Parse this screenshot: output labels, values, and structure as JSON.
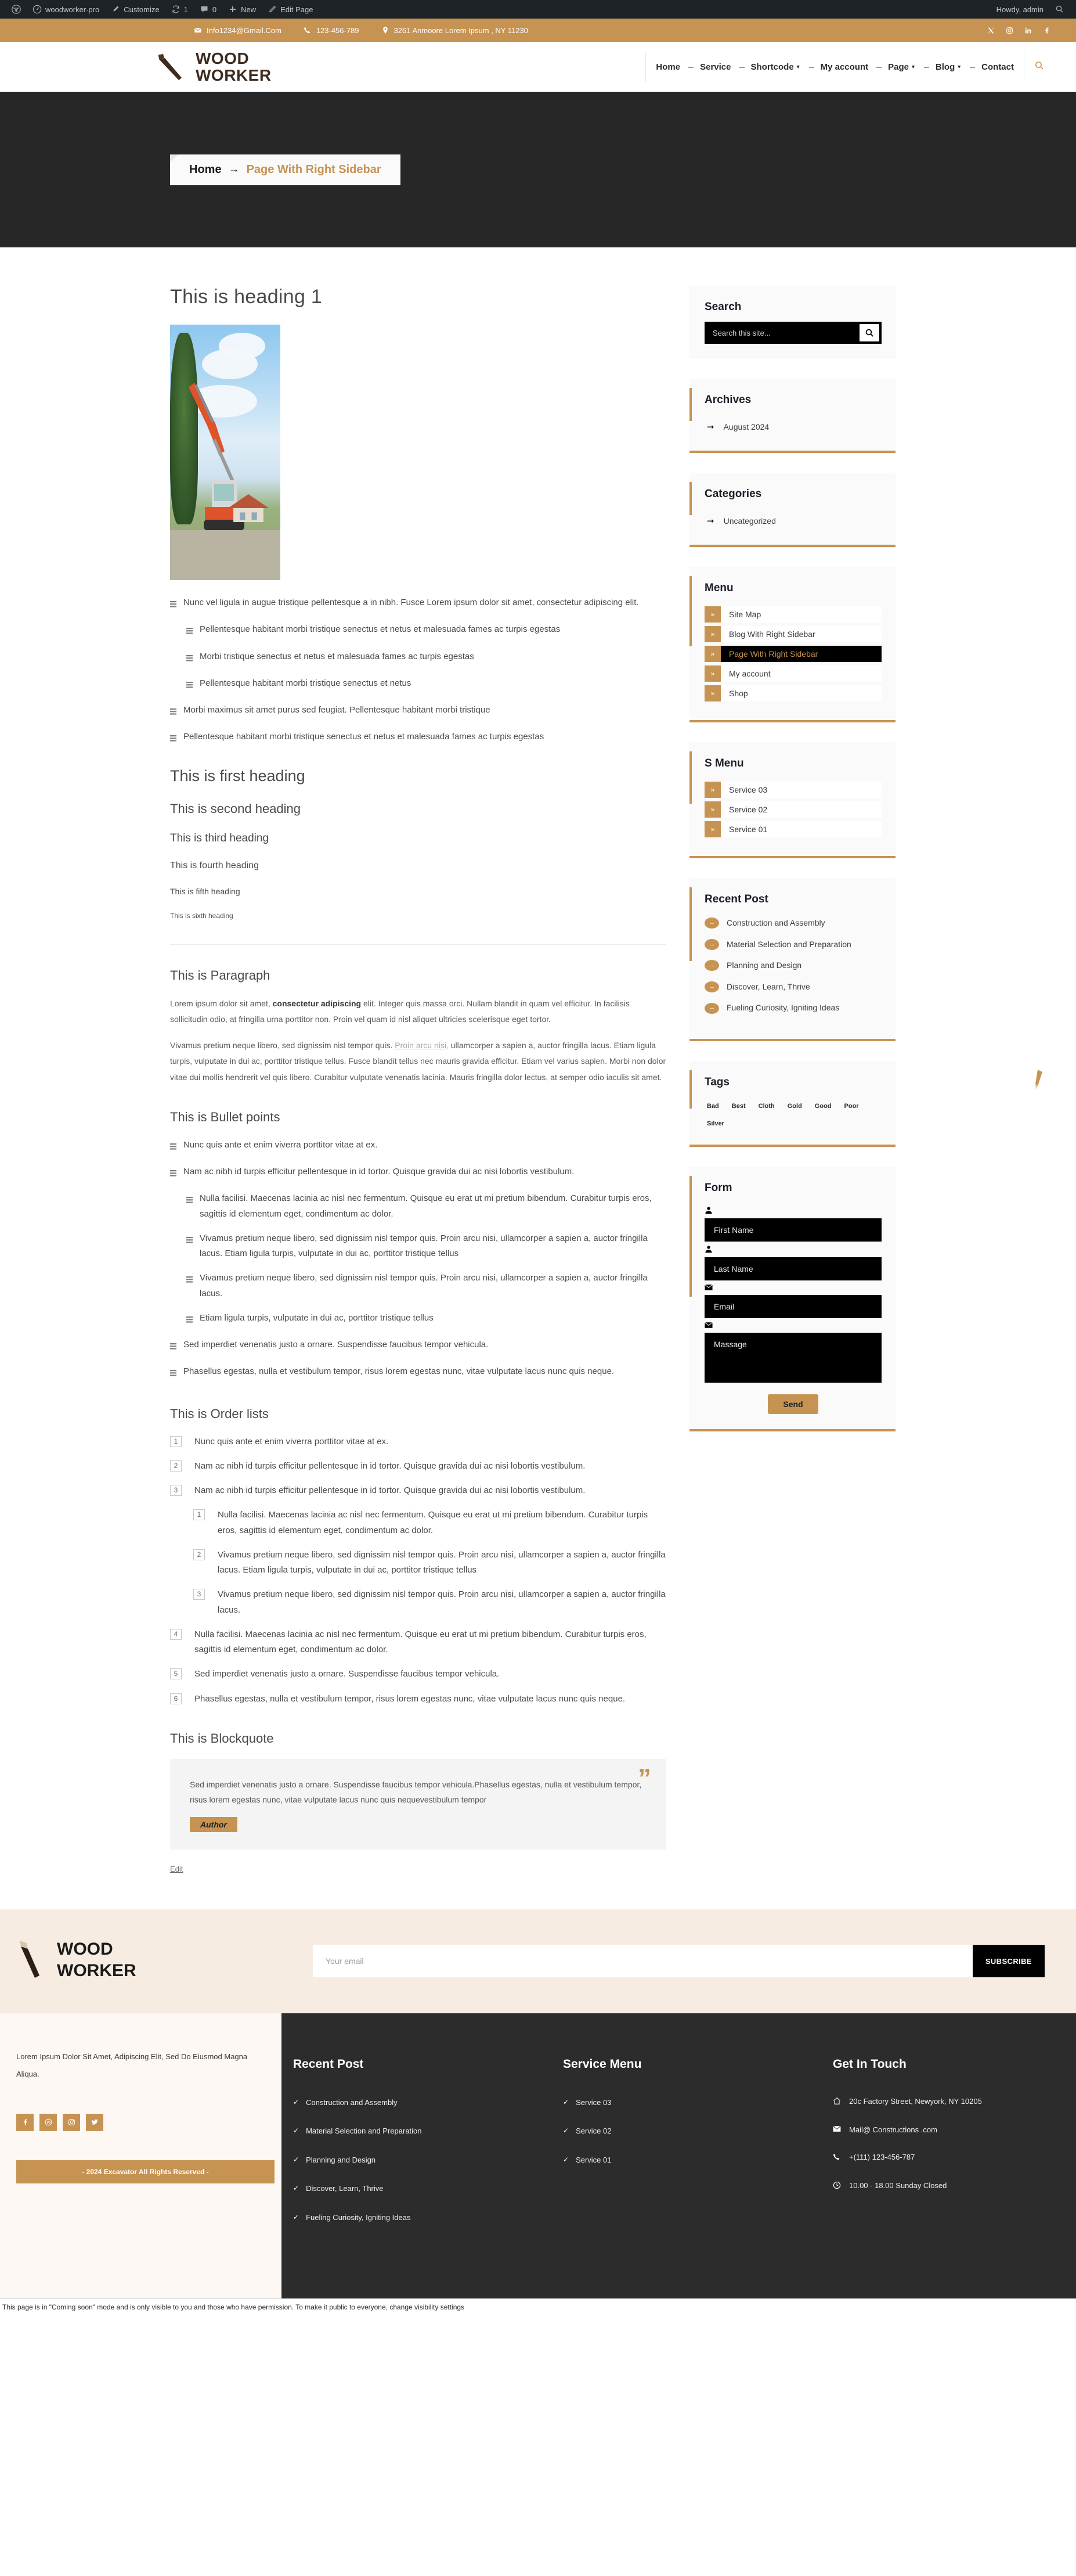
{
  "adminbar": {
    "items": [
      {
        "icon": "wordpress-logo-icon",
        "label": ""
      },
      {
        "icon": "dashboard-icon",
        "label": "woodworker-pro"
      },
      {
        "icon": "brush-icon",
        "label": "Customize"
      },
      {
        "icon": "updates-icon",
        "label": "1"
      },
      {
        "icon": "comment-icon",
        "label": "0"
      },
      {
        "icon": "plus-icon",
        "label": "New"
      },
      {
        "icon": "pencil-icon",
        "label": "Edit Page"
      }
    ],
    "howdy": "Howdy, admin"
  },
  "topbar": {
    "email": "Info1234@Gmail.Com",
    "phone": "123-456-789",
    "address": "3261 Anmoore Lorem Ipsum , NY 11230",
    "socials": [
      "x-icon",
      "instagram-icon",
      "linkedin-icon",
      "facebook-icon"
    ]
  },
  "header": {
    "brand_line1": "WOOD",
    "brand_line2": "WORKER",
    "nav": [
      {
        "label": "Home",
        "has_caret": false
      },
      {
        "label": "Service",
        "has_caret": false
      },
      {
        "label": "Shortcode",
        "has_caret": true
      },
      {
        "label": "My account",
        "has_caret": false
      },
      {
        "label": "Page",
        "has_caret": true
      },
      {
        "label": "Blog",
        "has_caret": true
      },
      {
        "label": "Contact",
        "has_caret": false
      }
    ]
  },
  "banner": {
    "home": "Home",
    "arrow": "→",
    "current": "Page With Right Sidebar"
  },
  "content": {
    "heading1": "This is heading 1",
    "bullets_top": [
      {
        "level": 0,
        "text": "Nunc vel ligula in augue tristique pellentesque a in nibh. Fusce Lorem ipsum dolor sit amet, consectetur adipiscing elit."
      },
      {
        "level": 1,
        "text": "Pellentesque habitant morbi tristique senectus et netus et malesuada fames ac turpis egestas"
      },
      {
        "level": 1,
        "text": "Morbi tristique senectus et netus et malesuada fames ac turpis egestas"
      },
      {
        "level": 1,
        "text": "Pellentesque habitant morbi tristique senectus et netus"
      },
      {
        "level": 0,
        "text": "Morbi maximus sit amet purus sed feugiat. Pellentesque habitant morbi tristique"
      },
      {
        "level": 0,
        "text": "Pellentesque habitant morbi tristique senectus et netus et malesuada fames ac turpis egestas"
      }
    ],
    "h_first": "This is first heading",
    "h_second": "This is second heading",
    "h_third": "This is third heading",
    "h_fourth": "This is fourth heading",
    "h_fifth": "This is fifth heading",
    "h_sixth": "This is sixth heading",
    "paragraph_title": "This is Paragraph",
    "para1_a": "Lorem ipsum dolor sit amet, ",
    "para1_b": "consectetur adipiscing",
    "para1_c": " elit. Integer quis massa orci. Nullam blandit in quam vel efficitur. In facilisis sollicitudin odio, at fringilla urna porttitor non. Proin vel quam id nisl aliquet ultricies scelerisque eget tortor.",
    "para2_a": "Vivamus pretium neque libero, sed dignissim nisl tempor quis. ",
    "para2_link": "Proin arcu nisi,",
    "para2_b": " ullamcorper a sapien a, auctor fringilla lacus. Etiam ligula turpis, vulputate in dui ac, porttitor tristique tellus. Fusce blandit tellus nec mauris gravida efficitur. Etiam vel varius sapien. Morbi non dolor vitae dui mollis hendrerit vel quis libero. Curabitur vulputate venenatis lacinia. Mauris fringilla dolor lectus, at semper odio iaculis sit amet.",
    "bullet_title": "This is Bullet points",
    "bullets_main": [
      {
        "level": 0,
        "text": "Nunc quis ante et enim viverra porttitor vitae at ex."
      },
      {
        "level": 0,
        "text": "Nam ac nibh id turpis efficitur pellentesque in id tortor. Quisque gravida dui ac nisi lobortis vestibulum."
      },
      {
        "level": 1,
        "text": "Nulla facilisi. Maecenas lacinia ac nisl nec fermentum. Quisque eu erat ut mi pretium bibendum. Curabitur turpis eros, sagittis id elementum eget, condimentum ac dolor."
      },
      {
        "level": 1,
        "text": "Vivamus pretium neque libero, sed dignissim nisl tempor quis. Proin arcu nisi, ullamcorper a sapien a, auctor fringilla lacus. Etiam ligula turpis, vulputate in dui ac, porttitor tristique tellus"
      },
      {
        "level": 1,
        "text": "Vivamus pretium neque libero, sed dignissim nisl tempor quis. Proin arcu nisi, ullamcorper a sapien a, auctor fringilla lacus."
      },
      {
        "level": 1,
        "text": "Etiam ligula turpis, vulputate in dui ac, porttitor tristique tellus"
      },
      {
        "level": 0,
        "text": "Sed imperdiet venenatis justo a ornare. Suspendisse faucibus tempor vehicula."
      },
      {
        "level": 0,
        "text": "Phasellus egestas, nulla et vestibulum tempor, risus lorem egestas nunc, vitae vulputate lacus nunc quis neque."
      }
    ],
    "order_title": "This is Order lists",
    "order_list": [
      {
        "level": 0,
        "num": "1",
        "text": "Nunc quis ante et enim viverra porttitor vitae at ex."
      },
      {
        "level": 0,
        "num": "2",
        "text": "Nam ac nibh id turpis efficitur pellentesque in id tortor. Quisque gravida dui ac nisi lobortis vestibulum."
      },
      {
        "level": 0,
        "num": "3",
        "text": "Nam ac nibh id turpis efficitur pellentesque in id tortor. Quisque gravida dui ac nisi lobortis vestibulum."
      },
      {
        "level": 1,
        "num": "1",
        "text": "Nulla facilisi. Maecenas lacinia ac nisl nec fermentum. Quisque eu erat ut mi pretium bibendum. Curabitur turpis eros, sagittis id elementum eget, condimentum ac dolor."
      },
      {
        "level": 1,
        "num": "2",
        "text": "Vivamus pretium neque libero, sed dignissim nisl tempor quis. Proin arcu nisi, ullamcorper a sapien a, auctor fringilla lacus. Etiam ligula turpis, vulputate in dui ac, porttitor tristique tellus"
      },
      {
        "level": 1,
        "num": "3",
        "text": "Vivamus pretium neque libero, sed dignissim nisl tempor quis. Proin arcu nisi, ullamcorper a sapien a, auctor fringilla lacus."
      },
      {
        "level": 0,
        "num": "4",
        "text": "Nulla facilisi. Maecenas lacinia ac nisl nec fermentum. Quisque eu erat ut mi pretium bibendum. Curabitur turpis eros, sagittis id elementum eget, condimentum ac dolor."
      },
      {
        "level": 0,
        "num": "5",
        "text": "Sed imperdiet venenatis justo a ornare. Suspendisse faucibus tempor vehicula."
      },
      {
        "level": 0,
        "num": "6",
        "text": "Phasellus egestas, nulla et vestibulum tempor, risus lorem egestas nunc, vitae vulputate lacus nunc quis neque."
      }
    ],
    "blockquote_title": "This is Blockquote",
    "blockquote_text": "Sed imperdiet venenatis justo a ornare. Suspendisse faucibus tempor vehicula.Phasellus egestas, nulla et vestibulum tempor, risus lorem egestas nunc, vitae vulputate lacus nunc quis nequevestibulum tempor",
    "blockquote_author": "Author",
    "edit": "Edit"
  },
  "sidebar": {
    "search": {
      "title": "Search",
      "placeholder": "Search this site...",
      "value": ""
    },
    "archives": {
      "title": "Archives",
      "items": [
        "August 2024"
      ]
    },
    "categories": {
      "title": "Categories",
      "items": [
        "Uncategorized"
      ]
    },
    "menu": {
      "title": "Menu",
      "items": [
        {
          "label": "Site Map",
          "active": false
        },
        {
          "label": "Blog With Right Sidebar",
          "active": false
        },
        {
          "label": "Page With Right Sidebar",
          "active": true
        },
        {
          "label": "My account",
          "active": false
        },
        {
          "label": "Shop",
          "active": false
        }
      ]
    },
    "smenu": {
      "title": "S Menu",
      "items": [
        {
          "label": "Service 03",
          "active": false
        },
        {
          "label": "Service 02",
          "active": false
        },
        {
          "label": "Service 01",
          "active": false
        }
      ]
    },
    "recent": {
      "title": "Recent Post",
      "items": [
        "Construction and Assembly",
        "Material Selection and Preparation",
        "Planning and Design",
        "Discover, Learn, Thrive",
        "Fueling Curiosity, Igniting Ideas"
      ]
    },
    "tags": {
      "title": "Tags",
      "items": [
        "Bad",
        "Best",
        "Cloth",
        "Gold",
        "Good",
        "Poor",
        "Silver"
      ]
    },
    "form": {
      "title": "Form",
      "first_name_placeholder": "First Name",
      "last_name_placeholder": "Last Name",
      "email_placeholder": "Email",
      "message_placeholder": "Massage",
      "send_label": "Send"
    }
  },
  "footer": {
    "brand_line1": "WOOD",
    "brand_line2": "WORKER",
    "subscribe_placeholder": "Your email",
    "subscribe_label": "SUBSCRIBE",
    "about": "Lorem Ipsum Dolor Sit Amet, Adipiscing Elit, Sed Do Eiusmod Magna Aliqua.",
    "socials": [
      "facebook-icon",
      "pinterest-icon",
      "instagram-icon",
      "twitter-icon"
    ],
    "copyright": "- 2024 Excavator All Rights Reserved -",
    "recent_post": {
      "title": "Recent Post",
      "items": [
        "Construction and Assembly",
        "Material Selection and Preparation",
        "Planning and Design",
        "Discover, Learn, Thrive",
        "Fueling Curiosity, Igniting Ideas"
      ]
    },
    "service_menu": {
      "title": "Service Menu",
      "items": [
        "Service 03",
        "Service 02",
        "Service 01"
      ]
    },
    "get_in_touch": {
      "title": "Get In Touch",
      "address": "20c Factory Street, Newyork, NY 10205",
      "email": "Mail@ Constructions .com",
      "phone": "+(111) 123-456-787",
      "hours": "10.00 - 18.00 Sunday Closed"
    }
  },
  "notice": {
    "text": "This page is in \"Coming soon\" mode and is only visible to you and those who have permission. To make it public to everyone, change visibility settings"
  },
  "colors": {
    "accent": "#c79353",
    "dark": "#272727",
    "adminbar": "#1d2327",
    "footer_dark": "#2c2c2c",
    "footer_cream": "#f6ece1"
  }
}
